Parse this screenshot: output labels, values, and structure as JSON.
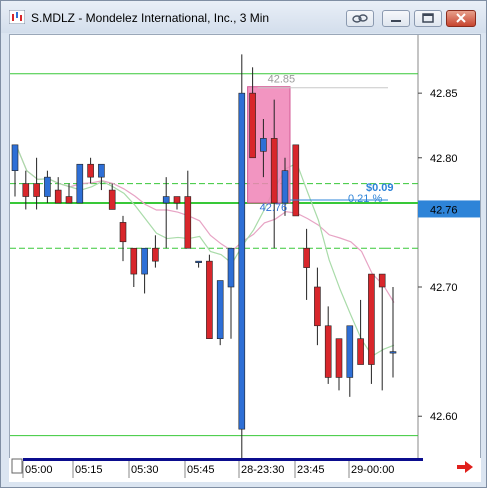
{
  "window": {
    "title": "S.MDLZ - Mondelez International, Inc., 3 Min"
  },
  "title_buttons": {
    "link_icon": "link-icon",
    "minimize_icon": "minimize-icon",
    "restore_icon": "restore-icon",
    "close_icon": "close-icon"
  },
  "colors": {
    "up_candle": "#2e6fd6",
    "down_candle": "#d8262b",
    "level_line": "#38c838",
    "selection_box": "#f083b6",
    "current_price_bg": "#2e84d8"
  },
  "chart_data": {
    "type": "candlestick",
    "ylim": [
      42.57,
      42.895
    ],
    "y_ticks": [
      "42.85",
      "42.80",
      "42.70",
      "42.60"
    ],
    "current_price_label": "42.76",
    "x_ticks": [
      "05:00",
      "05:15",
      "05:30",
      "05:45",
      "28-23:30",
      "23:45",
      "29-00:00"
    ],
    "annotations": {
      "high_label": "42.85",
      "low_label": "42.76",
      "change_value": "$0.09",
      "change_percent": "0.21 %"
    },
    "candles": [
      {
        "o": 42.79,
        "h": 42.81,
        "l": 42.77,
        "c": 42.81
      },
      {
        "o": 42.78,
        "h": 42.79,
        "l": 42.76,
        "c": 42.77
      },
      {
        "o": 42.78,
        "h": 42.8,
        "l": 42.76,
        "c": 42.77
      },
      {
        "o": 42.77,
        "h": 42.79,
        "l": 42.765,
        "c": 42.785
      },
      {
        "o": 42.775,
        "h": 42.785,
        "l": 42.765,
        "c": 42.765
      },
      {
        "o": 42.77,
        "h": 42.78,
        "l": 42.765,
        "c": 42.765
      },
      {
        "o": 42.765,
        "h": 42.795,
        "l": 42.765,
        "c": 42.795
      },
      {
        "o": 42.795,
        "h": 42.8,
        "l": 42.78,
        "c": 42.785
      },
      {
        "o": 42.785,
        "h": 42.795,
        "l": 42.775,
        "c": 42.795
      },
      {
        "o": 42.775,
        "h": 42.78,
        "l": 42.76,
        "c": 42.76
      },
      {
        "o": 42.75,
        "h": 42.755,
        "l": 42.72,
        "c": 42.735
      },
      {
        "o": 42.73,
        "h": 42.73,
        "l": 42.7,
        "c": 42.71
      },
      {
        "o": 42.71,
        "h": 42.73,
        "l": 42.695,
        "c": 42.73
      },
      {
        "o": 42.73,
        "h": 42.74,
        "l": 42.715,
        "c": 42.72
      },
      {
        "o": 42.765,
        "h": 42.785,
        "l": 42.73,
        "c": 42.77
      },
      {
        "o": 42.77,
        "h": 42.77,
        "l": 42.76,
        "c": 42.765
      },
      {
        "o": 42.77,
        "h": 42.79,
        "l": 42.73,
        "c": 42.73
      },
      {
        "o": 42.72,
        "h": 42.72,
        "l": 42.715,
        "c": 42.72
      },
      {
        "o": 42.72,
        "h": 42.725,
        "l": 42.66,
        "c": 42.66
      },
      {
        "o": 42.66,
        "h": 42.705,
        "l": 42.655,
        "c": 42.705
      },
      {
        "o": 42.7,
        "h": 42.73,
        "l": 42.66,
        "c": 42.73
      },
      {
        "o": 42.59,
        "h": 42.88,
        "l": 42.52,
        "c": 42.85
      },
      {
        "o": 42.85,
        "h": 42.87,
        "l": 42.8,
        "c": 42.8
      },
      {
        "o": 42.805,
        "h": 42.83,
        "l": 42.785,
        "c": 42.815
      },
      {
        "o": 42.815,
        "h": 42.845,
        "l": 42.73,
        "c": 42.765
      },
      {
        "o": 42.765,
        "h": 42.8,
        "l": 42.755,
        "c": 42.79
      },
      {
        "o": 42.81,
        "h": 42.81,
        "l": 42.755,
        "c": 42.755
      },
      {
        "o": 42.73,
        "h": 42.745,
        "l": 42.69,
        "c": 42.715
      },
      {
        "o": 42.7,
        "h": 42.715,
        "l": 42.655,
        "c": 42.67
      },
      {
        "o": 42.67,
        "h": 42.685,
        "l": 42.625,
        "c": 42.63
      },
      {
        "o": 42.66,
        "h": 42.66,
        "l": 42.62,
        "c": 42.63
      },
      {
        "o": 42.63,
        "h": 42.67,
        "l": 42.615,
        "c": 42.67
      },
      {
        "o": 42.66,
        "h": 42.69,
        "l": 42.64,
        "c": 42.64
      },
      {
        "o": 42.71,
        "h": 42.71,
        "l": 42.625,
        "c": 42.64
      },
      {
        "o": 42.71,
        "h": 42.71,
        "l": 42.62,
        "c": 42.7
      },
      {
        "o": 42.65,
        "h": 42.7,
        "l": 42.63,
        "c": 42.65
      }
    ],
    "levels": [
      {
        "value": 42.865,
        "style": "solid"
      },
      {
        "value": 42.78,
        "style": "dashed"
      },
      {
        "value": 42.765,
        "style": "solid-thick"
      },
      {
        "value": 42.73,
        "style": "dashed"
      },
      {
        "value": 42.585,
        "style": "solid"
      }
    ],
    "selection": {
      "from_index": 22,
      "to_index": 25,
      "high": 42.855,
      "low": 42.765
    }
  }
}
